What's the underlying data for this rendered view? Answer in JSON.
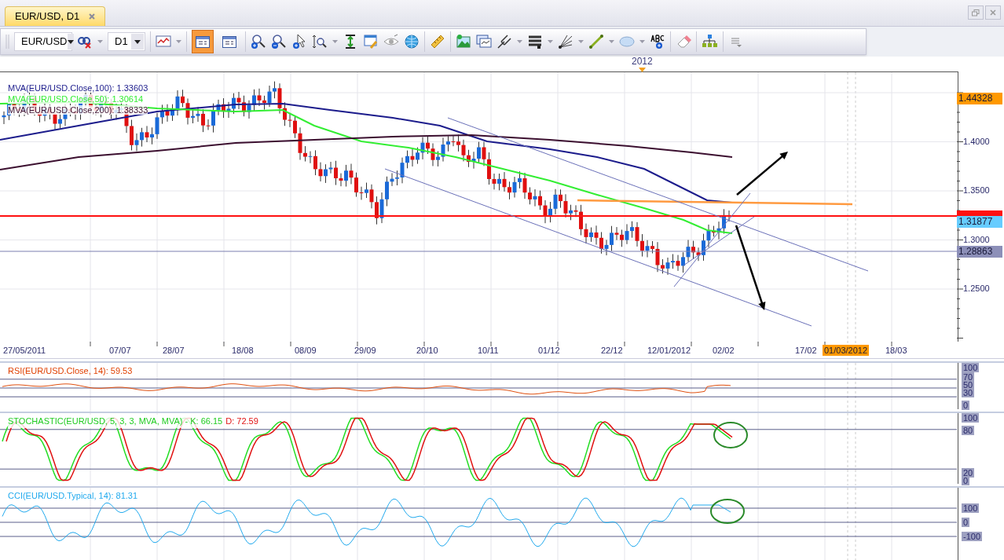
{
  "tab": {
    "title": "EUR/USD, D1",
    "selected": true
  },
  "toolbar": {
    "symbol": "EUR/USD",
    "timeframe": "D1",
    "toggles": [
      {
        "selected": true
      },
      {
        "selected": false
      }
    ]
  },
  "year_marker": "2012",
  "main_chart": {
    "legend": [
      {
        "text": "MVA(EUR/USD.Close,100): 1.33603",
        "color": "#1c1c8c"
      },
      {
        "text": "MVA(EUR/USD.Close,50): 1.30614",
        "color": "#33ee33"
      },
      {
        "text": "MVA(EUR/USD.Close,200): 1.38333",
        "color": "#3c1030"
      }
    ],
    "y_labels": [
      "1.4000",
      "1.3500",
      "1.3000",
      "1.2500"
    ],
    "price_badges": [
      {
        "text": "1.44328",
        "color": "#ff9900"
      },
      {
        "text": "1.31877",
        "color": "#66ccff"
      },
      {
        "text": "1.28863",
        "color": "#8c8fb8"
      }
    ]
  },
  "x_axis": [
    {
      "label": "27/05/2011",
      "highlighted": false
    },
    {
      "label": "07/07",
      "highlighted": false
    },
    {
      "label": "28/07",
      "highlighted": false
    },
    {
      "label": "18/08",
      "highlighted": false
    },
    {
      "label": "08/09",
      "highlighted": false
    },
    {
      "label": "29/09",
      "highlighted": false
    },
    {
      "label": "20/10",
      "highlighted": false
    },
    {
      "label": "10/11",
      "highlighted": false
    },
    {
      "label": "01/12",
      "highlighted": false
    },
    {
      "label": "22/12",
      "highlighted": false
    },
    {
      "label": "12/01/2012",
      "highlighted": false
    },
    {
      "label": "02/02",
      "highlighted": false
    },
    {
      "label": "17/02",
      "highlighted": false
    },
    {
      "label": "01/03/2012",
      "highlighted": true
    },
    {
      "label": "18/03",
      "highlighted": false
    }
  ],
  "rsi": {
    "legend": "RSI(EUR/USD.Close, 14): 59.53",
    "y_labels": [
      "100",
      "70",
      "50",
      "30",
      "0"
    ]
  },
  "stochastic": {
    "legend": "STOCHASTIC(EUR/USD, 5, 3, 3, MVA, MVA) -  K: 66.15",
    "signal": "D: 72.59",
    "y_labels": [
      "100",
      "80",
      "20",
      "0"
    ]
  },
  "cci": {
    "legend": "CCI(EUR/USD.Typical, 14): 81.31",
    "y_labels": [
      "100",
      "0",
      "-100"
    ]
  }
}
